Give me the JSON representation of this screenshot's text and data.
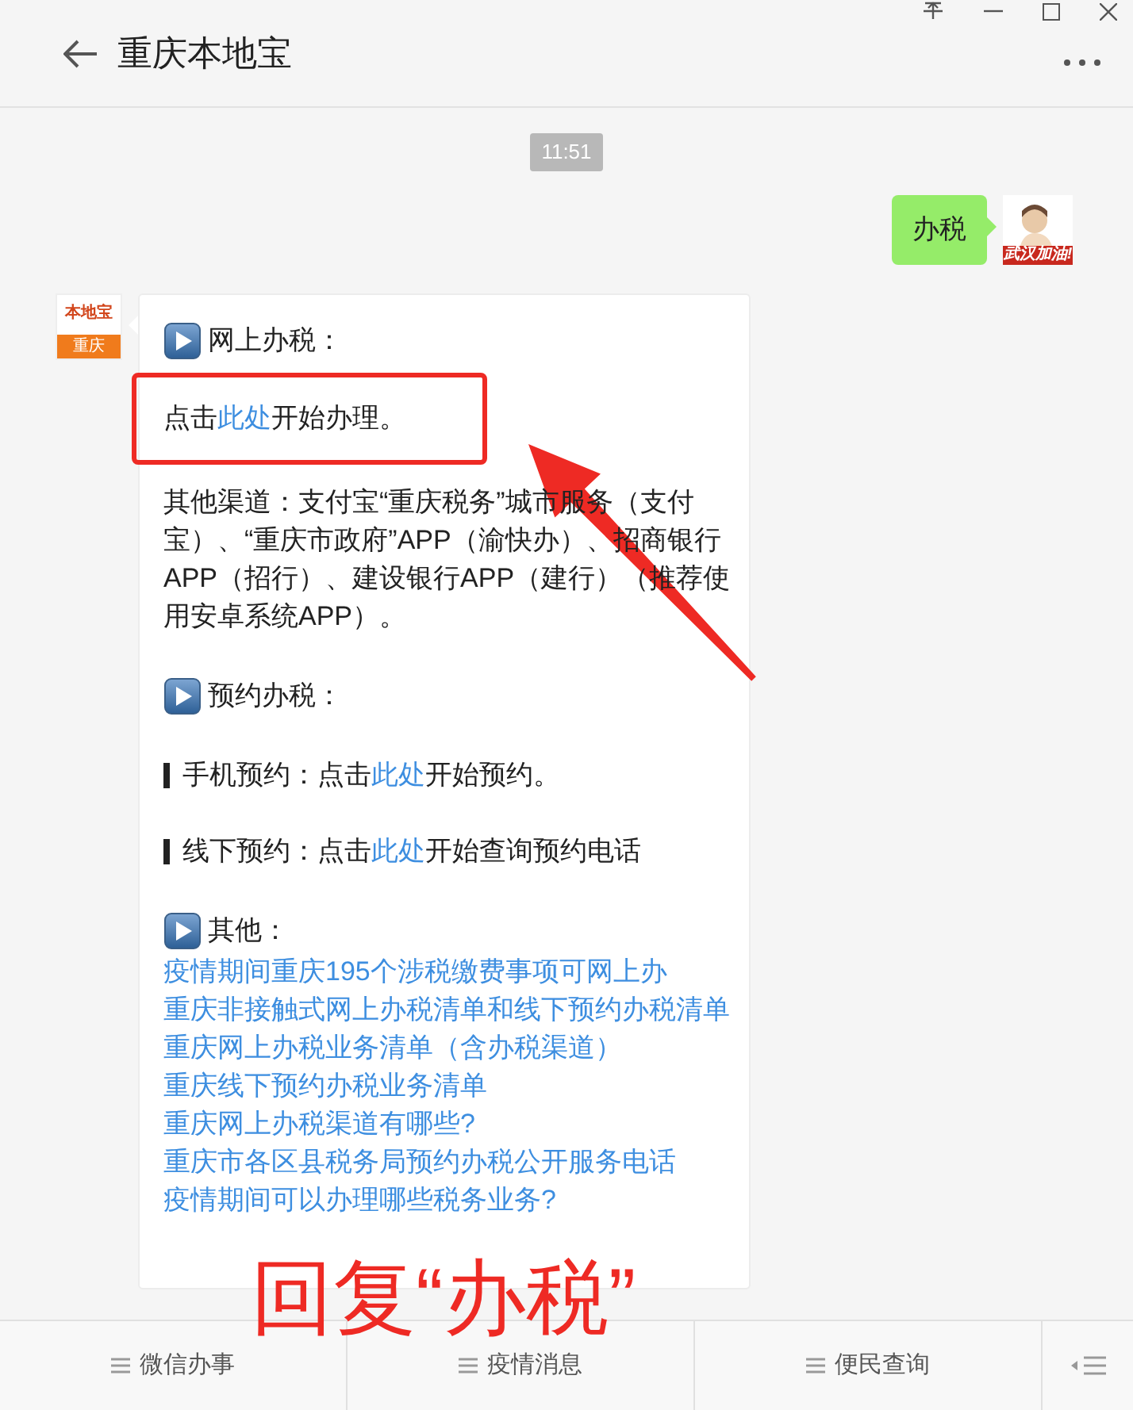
{
  "window": {
    "title": "重庆本地宝"
  },
  "timestamp": "11:51",
  "outgoing": {
    "text": "办税",
    "avatar_caption": "武汉加油!"
  },
  "incoming": {
    "avatar": {
      "name": "本地宝",
      "city": "重庆"
    },
    "sections": [
      {
        "heading": "网上办税：",
        "blocks": [
          {
            "kind": "paragraph",
            "boxed": true,
            "parts": [
              {
                "text": "点击",
                "link": false
              },
              {
                "text": "此处",
                "link": true
              },
              {
                "text": "开始办理。",
                "link": false
              }
            ]
          },
          {
            "kind": "paragraph",
            "boxed": false,
            "parts": [
              {
                "text": "其他渠道：支付宝“重庆税务”城市服务（支付宝）、“重庆市政府”APP（渝快办）、招商银行APP（招行）、建设银行APP（建行）（推荐使用安卓系统APP）。",
                "link": false
              }
            ]
          }
        ]
      },
      {
        "heading": "预约办税：",
        "blocks": [
          {
            "kind": "bullet",
            "boxed": false,
            "parts": [
              {
                "text": "手机预约：点击",
                "link": false
              },
              {
                "text": "此处",
                "link": true
              },
              {
                "text": "开始预约。",
                "link": false
              }
            ]
          },
          {
            "kind": "bullet",
            "boxed": false,
            "parts": [
              {
                "text": "线下预约：点击",
                "link": false
              },
              {
                "text": "此处",
                "link": true
              },
              {
                "text": "开始查询预约电话",
                "link": false
              }
            ]
          }
        ]
      },
      {
        "heading": "其他：",
        "blocks": [
          {
            "kind": "links",
            "items": [
              "疫情期间重庆195个涉税缴费事项可网上办",
              "重庆非接触式网上办税清单和线下预约办税清单",
              "重庆网上办税业务清单（含办税渠道）",
              "重庆线下预约办税业务清单",
              "重庆网上办税渠道有哪些?",
              "重庆市各区县税务局预约办税公开服务电话",
              "疫情期间可以办理哪些税务业务?"
            ]
          }
        ]
      }
    ]
  },
  "annotation": {
    "text": "回复“办税”"
  },
  "menu": [
    {
      "label": "微信办事"
    },
    {
      "label": "疫情消息"
    },
    {
      "label": "便民查询"
    }
  ]
}
